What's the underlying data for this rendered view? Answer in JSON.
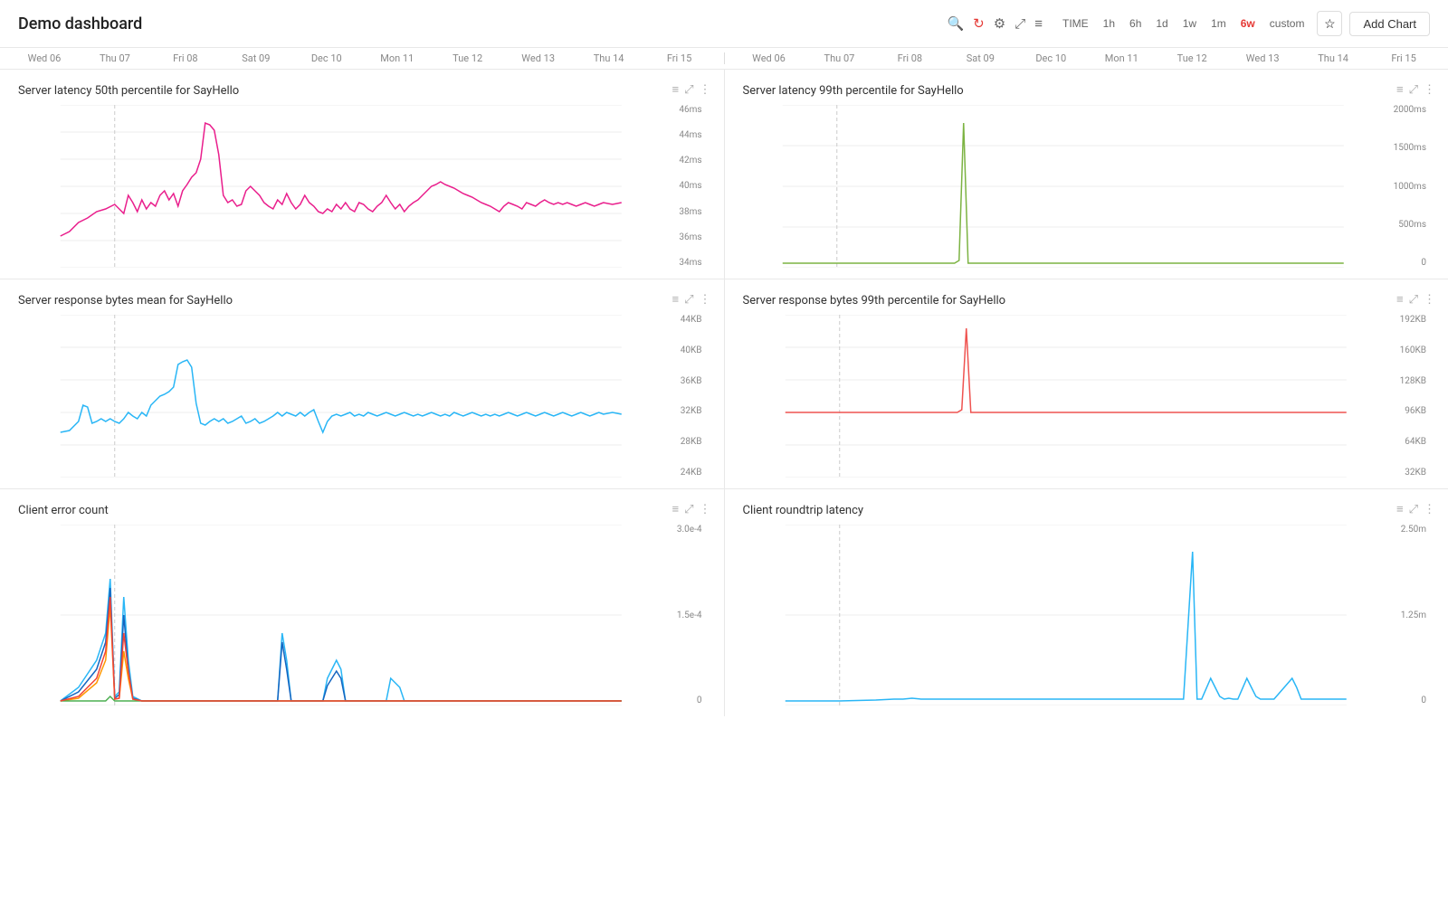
{
  "header": {
    "title": "Demo dashboard",
    "icons": [
      "search",
      "refresh",
      "settings",
      "fullscreen",
      "menu"
    ],
    "time_buttons": [
      "TIME",
      "1h",
      "6h",
      "1d",
      "1w",
      "1m",
      "6w",
      "custom"
    ],
    "active_time": "6w",
    "star_label": "☆",
    "add_chart_label": "Add Chart"
  },
  "timeline": {
    "top_dates": [
      "Wed 06",
      "Thu 07",
      "Fri 08",
      "Sat 09",
      "Dec 10",
      "Mon 11",
      "Tue 12",
      "Wed 13",
      "Thu 14",
      "Fri 15"
    ],
    "bottom_dates": [
      "Wed 06",
      "Thu 07",
      "Fri 08",
      "Sat 09",
      "Dec 10",
      "Mon 11",
      "Tue 12",
      "Wed 13",
      "Thu 14",
      "Fri 15"
    ]
  },
  "charts": [
    {
      "id": "chart1",
      "title": "Server latency 50th percentile for SayHello",
      "y_labels": [
        "46ms",
        "44ms",
        "42ms",
        "40ms",
        "38ms",
        "36ms",
        "34ms"
      ],
      "color": "#e91e8c"
    },
    {
      "id": "chart2",
      "title": "Server latency 99th percentile for SayHello",
      "y_labels": [
        "2000ms",
        "1500ms",
        "1000ms",
        "500ms",
        "0"
      ],
      "color": "#7cb342"
    },
    {
      "id": "chart3",
      "title": "Server response bytes mean for SayHello",
      "y_labels": [
        "44KB",
        "40KB",
        "36KB",
        "32KB",
        "28KB",
        "24KB"
      ],
      "color": "#29b6f6"
    },
    {
      "id": "chart4",
      "title": "Server response bytes 99th percentile for SayHello",
      "y_labels": [
        "192KB",
        "160KB",
        "128KB",
        "96KB",
        "64KB",
        "32KB"
      ],
      "color": "#ef5350"
    },
    {
      "id": "chart5",
      "title": "Client error count",
      "y_labels": [
        "3.0e-4",
        "1.5e-4",
        "0"
      ],
      "color": "#29b6f6"
    },
    {
      "id": "chart6",
      "title": "Client roundtrip latency",
      "y_labels": [
        "2.50m",
        "1.25m",
        "0"
      ],
      "color": "#29b6f6"
    }
  ]
}
